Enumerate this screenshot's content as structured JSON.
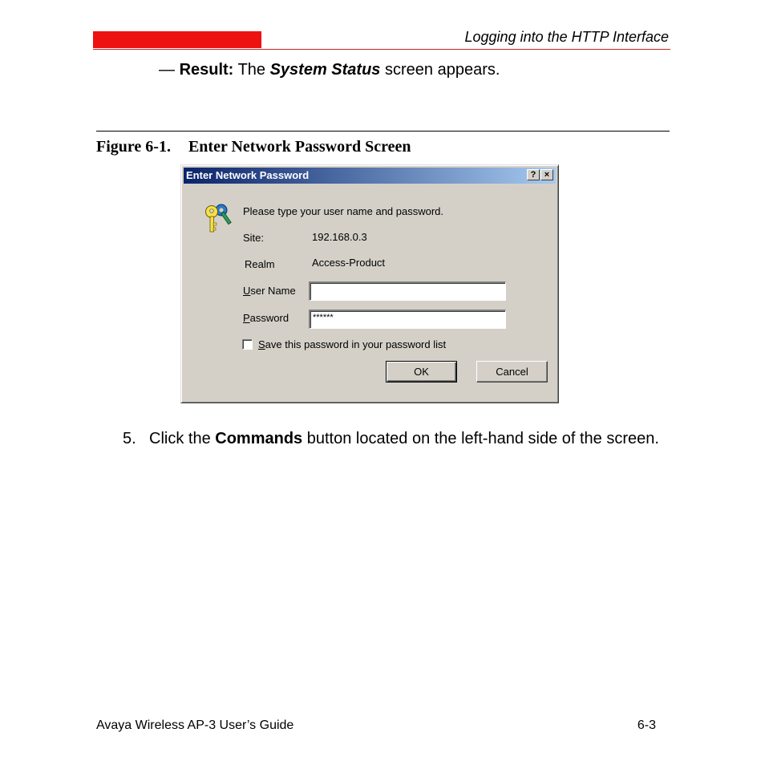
{
  "header": {
    "section_title": "Logging into the HTTP Interface",
    "accent_color": "#ee1111"
  },
  "result": {
    "dash": "—",
    "label": "Result:",
    "text_before": "The",
    "screen_name": "System Status",
    "text_after": "screen appears."
  },
  "figure": {
    "number": "Figure 6-1.",
    "title": "Enter Network Password Screen"
  },
  "dialog": {
    "title": "Enter Network Password",
    "help_button": "?",
    "close_button": "×",
    "icon": "keys-icon",
    "prompt": "Please type your user name and password.",
    "site_label": "Site:",
    "site_value": "192.168.0.3",
    "realm_label": "Realm",
    "realm_value": "Access-Product",
    "username_label_mnemonic": "U",
    "username_label_rest": "ser Name",
    "username_value": "",
    "password_label_mnemonic": "P",
    "password_label_rest": "assword",
    "password_value": "******",
    "save_password_mnemonic": "S",
    "save_password_rest": "ave this password in your password list",
    "save_password_checked": false,
    "ok_label": "OK",
    "cancel_label": "Cancel"
  },
  "step": {
    "number": "5.",
    "text_before": "Click the",
    "bold": "Commands",
    "text_after": "button located on the left-hand side of the screen."
  },
  "footer": {
    "left": "Avaya Wireless AP-3 User’s Guide",
    "right": "6-3"
  }
}
